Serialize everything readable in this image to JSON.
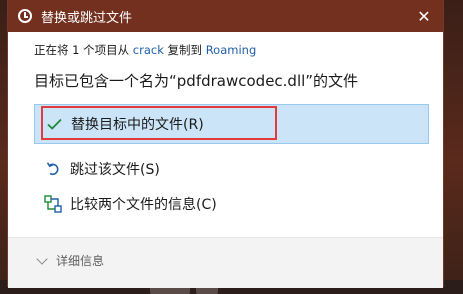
{
  "window": {
    "title": "替换或跳过文件",
    "close_glyph": "✕"
  },
  "message": {
    "prefix": "正在将 1 个项目从",
    "source": "crack",
    "middle": "复制到",
    "destination": "Roaming",
    "heading": "目标已包含一个名为“pdfdrawcodec.dll”的文件"
  },
  "options": [
    {
      "label": "替换目标中的文件(R)",
      "icon": "check-icon",
      "selected": true
    },
    {
      "label": "跳过该文件(S)",
      "icon": "skip-arrow-icon",
      "selected": false
    },
    {
      "label": "比较两个文件的信息(C)",
      "icon": "compare-icon",
      "selected": false
    }
  ],
  "footer": {
    "details_label": "详细信息"
  },
  "colors": {
    "titlebar": "#74301f",
    "selection_fill": "#cce4f7",
    "annotation_red": "#e13b3b",
    "link_blue": "#1f5fa8",
    "check_green": "#1d8a3a"
  }
}
